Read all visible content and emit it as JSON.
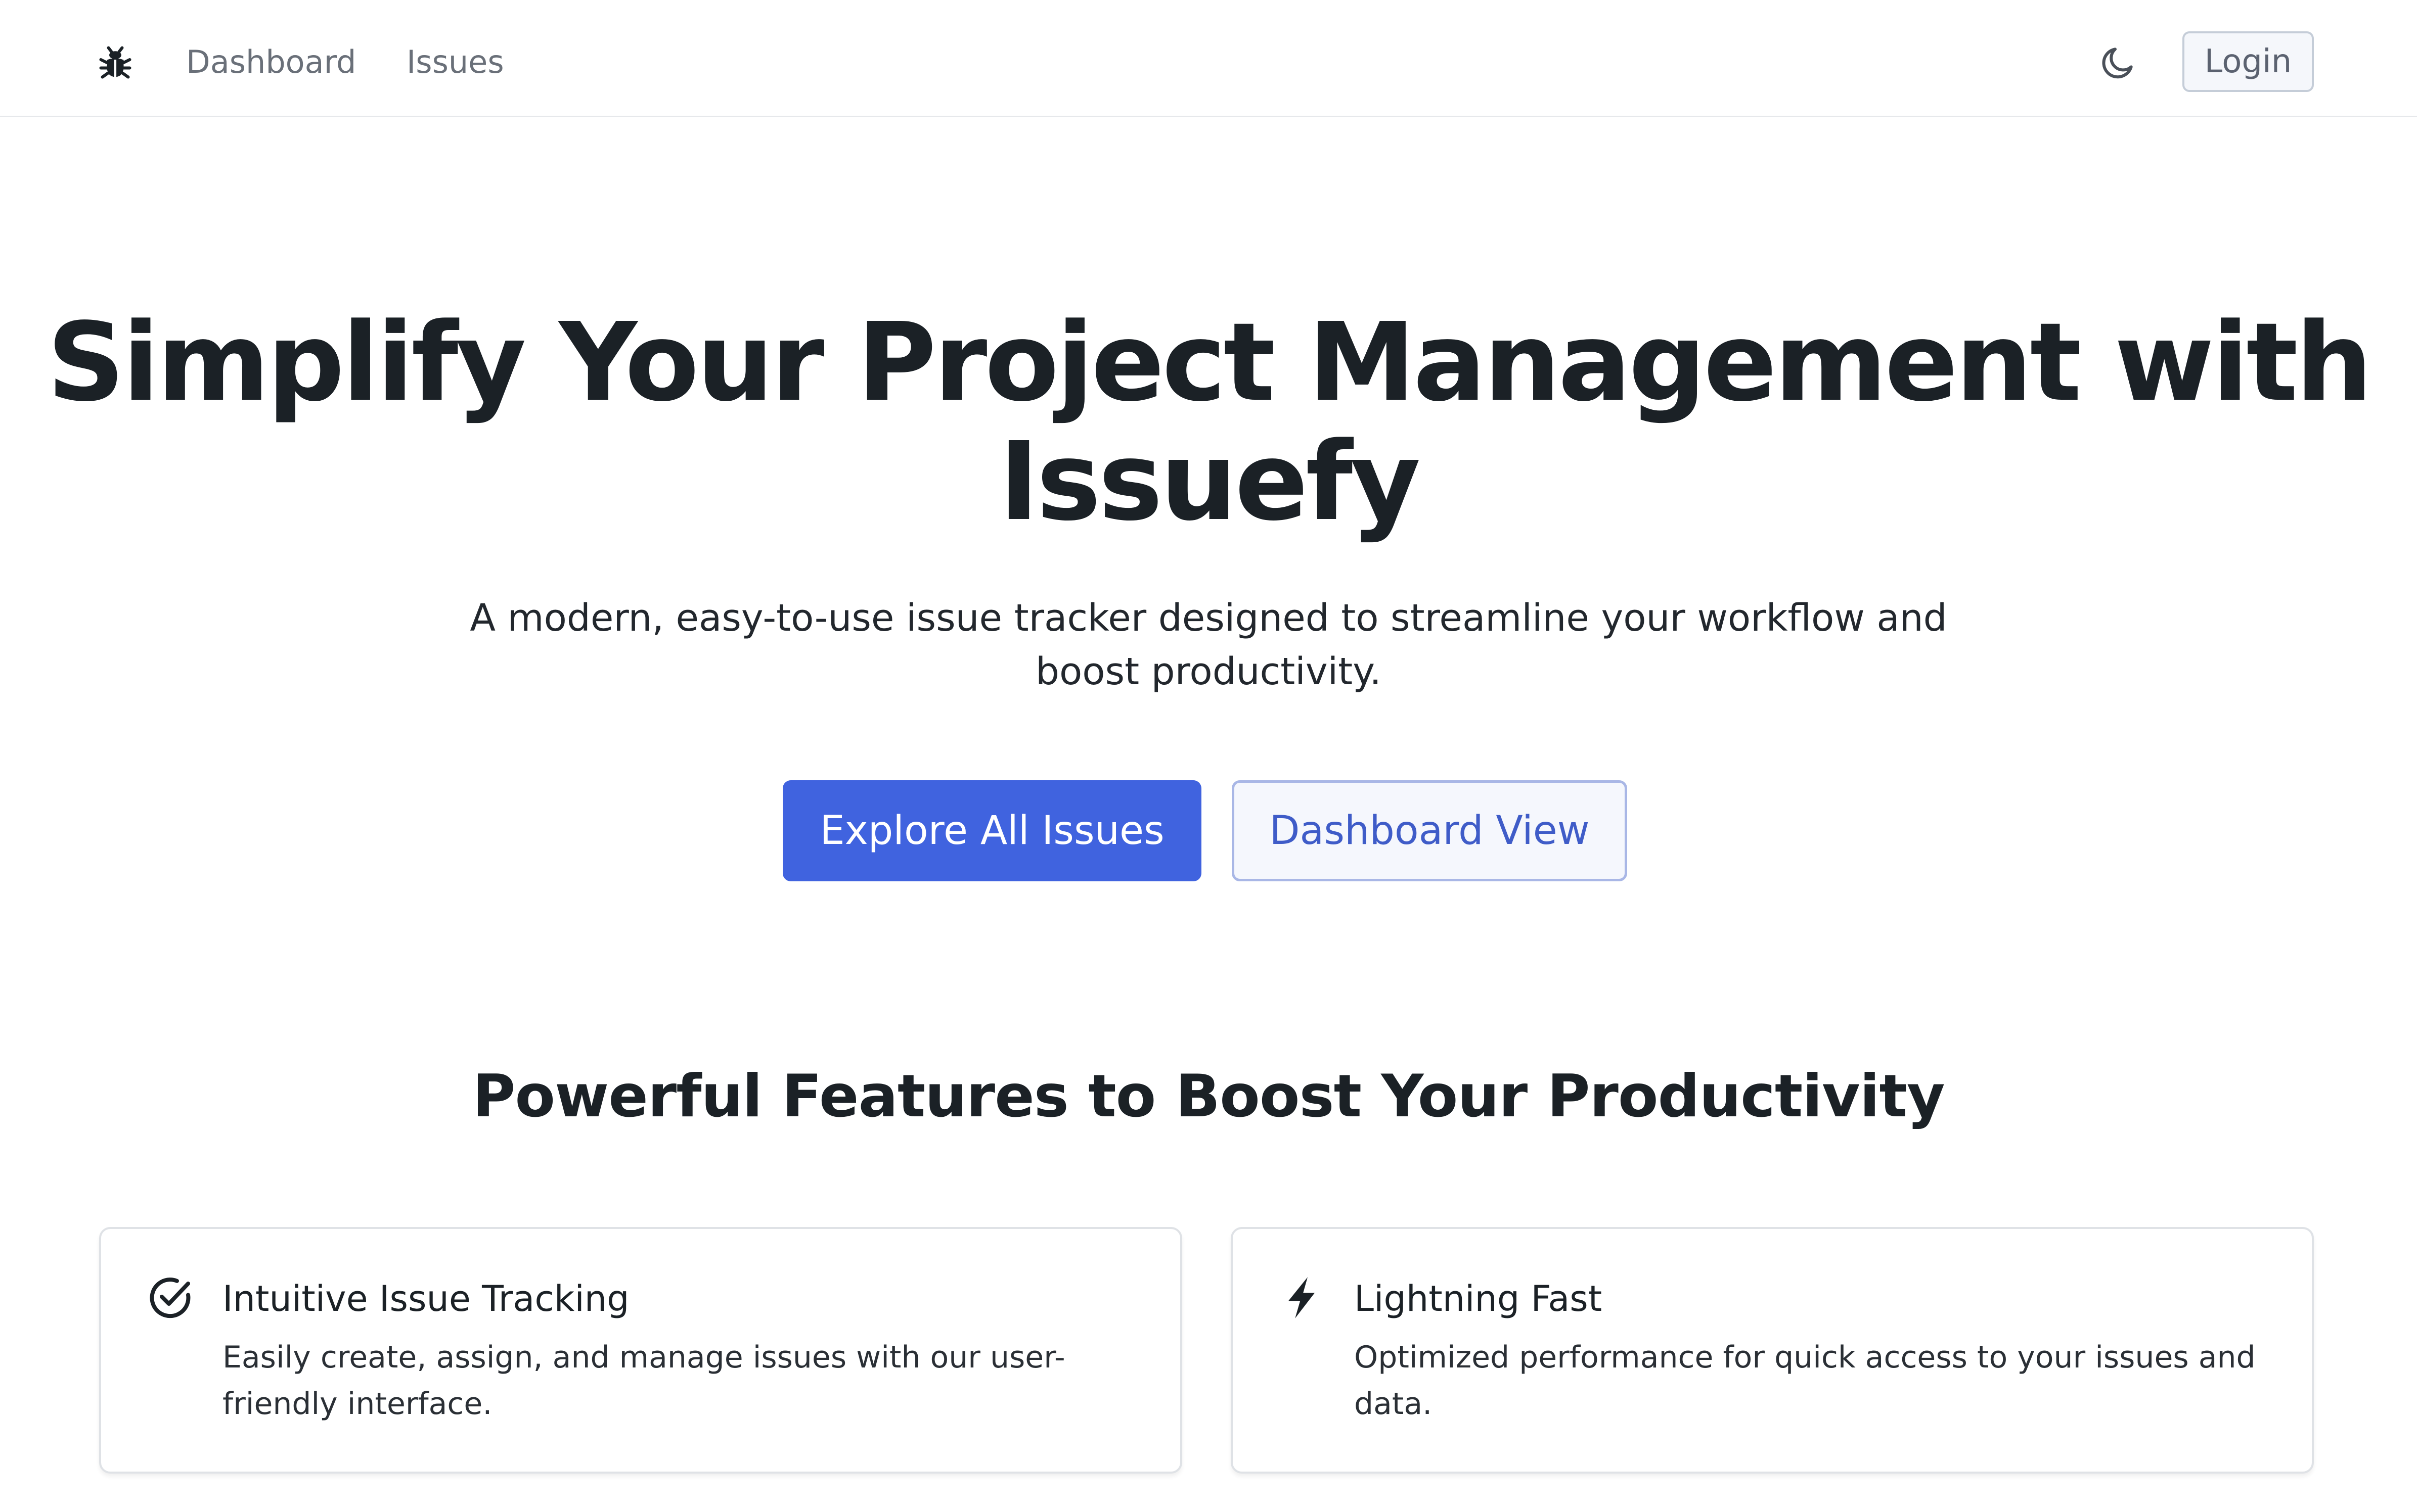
{
  "header": {
    "logo_icon": "bug-icon",
    "nav": [
      {
        "label": "Dashboard"
      },
      {
        "label": "Issues"
      }
    ],
    "theme_toggle_icon": "moon-icon",
    "login_label": "Login"
  },
  "hero": {
    "title": "Simplify Your Project Management with Issuefy",
    "subtitle": "A modern, easy-to-use issue tracker designed to streamline your workflow and boost productivity.",
    "primary_button": "Explore All Issues",
    "secondary_button": "Dashboard View"
  },
  "features": {
    "heading": "Powerful Features to Boost Your Productivity",
    "cards": [
      {
        "icon": "check-circle-icon",
        "title": "Intuitive Issue Tracking",
        "description": "Easily create, assign, and manage issues with our user-friendly interface."
      },
      {
        "icon": "lightning-icon",
        "title": "Lightning Fast",
        "description": "Optimized performance for quick access to your issues and data."
      }
    ]
  },
  "colors": {
    "primary": "#4063df",
    "text": "#1b2126",
    "muted": "#6a7079",
    "border": "#dfe2e6"
  }
}
